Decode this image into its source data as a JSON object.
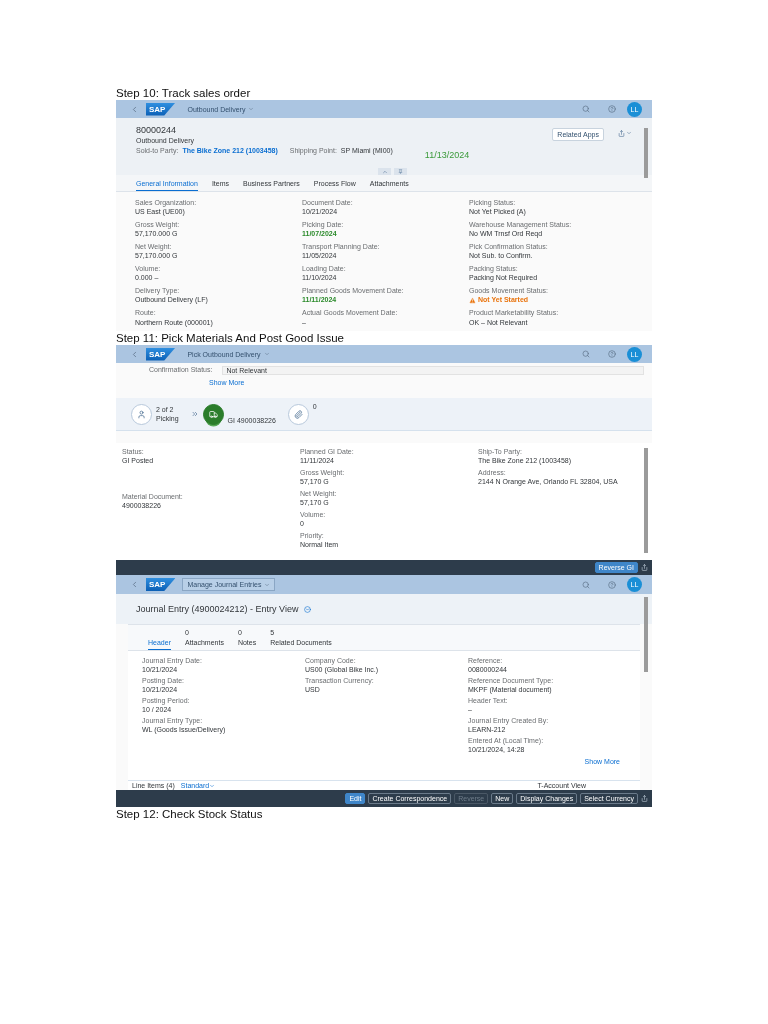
{
  "sections": [
    {
      "heading": "Step 10: Track sales order",
      "screens": [
        {
          "kind": "delivery_object",
          "shell": {
            "logo": "SAP",
            "app_title": "Outbound Delivery",
            "focused": false,
            "avatar": "LL"
          },
          "header": {
            "title": "80000244",
            "subtitle": "Outbound Delivery",
            "attributes": [
              {
                "label": "Sold-to Party:",
                "value": "The Bike Zone 212 (1003458)",
                "color": "#0a6ed1"
              },
              {
                "label": "Shipping Point:",
                "value": "SP Miami (MI00)"
              }
            ],
            "annotation": "11/13/2024",
            "action": "Related Apps"
          },
          "tabs": [
            {
              "label": "General Information",
              "selected": true
            },
            {
              "label": "Items",
              "selected": false
            },
            {
              "label": "Business Partners",
              "selected": false
            },
            {
              "label": "Process Flow",
              "selected": false
            },
            {
              "label": "Attachments",
              "selected": false
            }
          ],
          "columns": [
            [
              {
                "label": "Sales Organization:",
                "value": "US East (UE00)"
              },
              {
                "label": "Gross Weight:",
                "value": "57,170.000  G"
              },
              {
                "label": "Net Weight:",
                "value": "57,170.000  G"
              },
              {
                "label": "Volume:",
                "value": "0.000  –"
              },
              {
                "label": "Delivery Type:",
                "value": "Outbound Delivery (LF)"
              },
              {
                "label": "Route:",
                "value": "Northern Route (000001)"
              }
            ],
            [
              {
                "label": "Document Date:",
                "value": "10/21/2024"
              },
              {
                "label": "Picking Date:",
                "value": "11/07/2024",
                "color": "#2b8a2b"
              },
              {
                "label": "Transport Planning Date:",
                "value": "11/05/2024"
              },
              {
                "label": "Loading Date:",
                "value": "11/10/2024"
              },
              {
                "label": "Planned Goods Movement Date:",
                "value": "11/11/2024",
                "color": "#2b8a2b"
              },
              {
                "label": "Actual Goods Movement Date:",
                "value": "–"
              }
            ],
            [
              {
                "label": "Picking Status:",
                "value": "Not Yet Picked (A)"
              },
              {
                "label": "Warehouse Management Status:",
                "value": "No WM Trnsf Ord Reqd"
              },
              {
                "label": "Pick Confirmation Status:",
                "value": "Not Sub. to Confirm."
              },
              {
                "label": "Packing Status:",
                "value": "Packing Not Required"
              },
              {
                "label": "Goods Movement Status:",
                "value": "Not Yet Started",
                "color": "#e9730c",
                "alert": true
              },
              {
                "label": "Product Marketability Status:",
                "value": "OK – Not Relevant"
              }
            ]
          ]
        }
      ]
    },
    {
      "heading": "Step 11: Pick Materials And Post Good Issue",
      "screens": [
        {
          "kind": "pick_delivery",
          "shell": {
            "logo": "SAP",
            "app_title": "Pick Outbound Delivery",
            "focused": false,
            "avatar": "LL"
          },
          "confirmation": {
            "label": "Confirmation Status:",
            "value": "Not Relevant"
          },
          "show_more": "Show More",
          "flow": [
            {
              "kind": "person",
              "count": "2 of 2",
              "label": "Picking",
              "selected": false
            },
            {
              "kind": "truck",
              "label": "GI 4900038226",
              "selected": true
            },
            {
              "kind": "attachment",
              "count": "0",
              "selected": false
            }
          ],
          "columns": [
            [
              {
                "label": "Status:",
                "value": "GI Posted"
              },
              {
                "label": "Material Document:",
                "value": "4900038226"
              }
            ],
            [
              {
                "label": "Planned GI Date:",
                "value": "11/11/2024"
              },
              {
                "label": "Gross Weight:",
                "value": "57,170 G"
              },
              {
                "label": "Net Weight:",
                "value": "57,170 G"
              },
              {
                "label": "Volume:",
                "value": "0"
              },
              {
                "label": "Priority:",
                "value": "Normal Item"
              }
            ],
            [
              {
                "label": "Ship-To Party:",
                "value": "The Bike Zone 212 (1003458)"
              },
              {
                "label": "Address:",
                "value": "2144 N Orange Ave, Orlando FL 32804, USA"
              }
            ]
          ],
          "footer": [
            {
              "label": "Reverse GI",
              "emphasized": true,
              "disabled": false
            }
          ]
        },
        {
          "kind": "journal_entry",
          "shell": {
            "logo": "SAP",
            "app_title": "Manage Journal Entries",
            "focused": true,
            "avatar": "LL"
          },
          "title": "Journal Entry (4900024212) - Entry View",
          "tabs": [
            {
              "label": "Header",
              "selected": true
            },
            {
              "count": "0",
              "label": "Attachments",
              "selected": false
            },
            {
              "count": "0",
              "label": "Notes",
              "selected": false
            },
            {
              "count": "5",
              "label": "Related Documents",
              "selected": false
            }
          ],
          "columns": [
            [
              {
                "label": "Journal Entry Date:",
                "value": "10/21/2024"
              },
              {
                "label": "Posting Date:",
                "value": "10/21/2024"
              },
              {
                "label": "Posting Period:",
                "value": "10 / 2024"
              },
              {
                "label": "Journal Entry Type:",
                "value": "WL (Goods Issue/Delivery)"
              }
            ],
            [
              {
                "label": "Company Code:",
                "value": "US00 (Global Bike Inc.)"
              },
              {
                "label": "Transaction Currency:",
                "value": "USD"
              }
            ],
            [
              {
                "label": "Reference:",
                "value": "0080000244"
              },
              {
                "label": "Reference Document Type:",
                "value": "MKPF (Material document)"
              },
              {
                "label": "Header Text:",
                "value": "–"
              },
              {
                "label": "Journal Entry Created By:",
                "value": "LEARN-212"
              },
              {
                "label": "Entered At (Local Time):",
                "value": "10/21/2024, 14:28"
              }
            ]
          ],
          "show_more": "Show More",
          "line_items": {
            "title": "Line Items (4)",
            "variant": "Standard",
            "view": "T-Account View"
          },
          "footer": [
            {
              "label": "Edit",
              "emphasized": true,
              "disabled": false
            },
            {
              "label": "Create Correspondence",
              "emphasized": false,
              "disabled": false
            },
            {
              "label": "Reverse",
              "emphasized": false,
              "disabled": true
            },
            {
              "label": "New",
              "emphasized": false,
              "disabled": false
            },
            {
              "label": "Display Changes",
              "emphasized": false,
              "disabled": false
            },
            {
              "label": "Select Currency",
              "emphasized": false,
              "disabled": false
            }
          ]
        }
      ]
    }
  ],
  "closing_heading": "Step 12: Check Stock Status"
}
